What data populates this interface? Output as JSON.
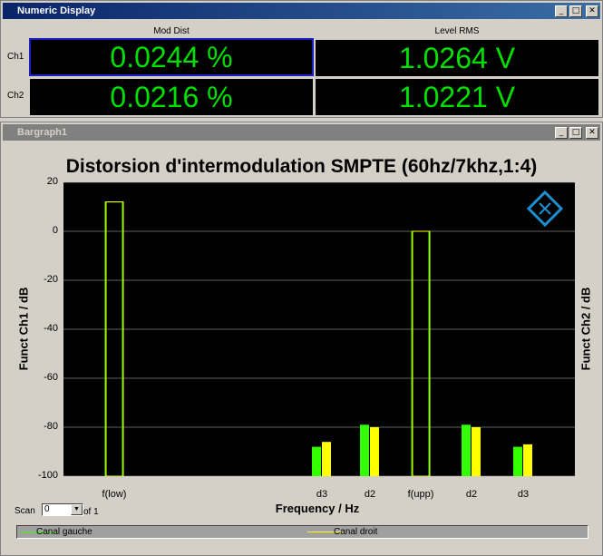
{
  "numeric": {
    "title": "Numeric Display",
    "col1": "Mod Dist",
    "col2": "Level RMS",
    "rows": [
      {
        "label": "Ch1",
        "mod": "0.0244 %",
        "level": "1.0264 V"
      },
      {
        "label": "Ch2",
        "mod": "0.0216 %",
        "level": "1.0221 V"
      }
    ]
  },
  "bargraph": {
    "title": "Bargraph1",
    "scan_label": "Scan",
    "scan_value": "0",
    "scan_of": "of 1"
  },
  "window_buttons": {
    "minimize": "_",
    "maximize": "□",
    "close": "✕"
  },
  "colors": {
    "green": "#33ff00",
    "yellow": "#ffff00",
    "value_text": "#00e000"
  },
  "chart_data": {
    "type": "bar",
    "title": "Distorsion d'intermodulation SMPTE (60hz/7khz,1:4)",
    "xlabel": "Frequency / Hz",
    "ylabel": "Funct Ch1 / dB",
    "ylabel_right": "Funct Ch2 / dB",
    "ylim": [
      -100,
      20
    ],
    "yticks": [
      "20",
      "0",
      "-20",
      "-40",
      "-60",
      "-80",
      "-100"
    ],
    "grid": true,
    "categories": [
      "f(low)",
      "d3",
      "d2",
      "f(upp)",
      "d2",
      "d3"
    ],
    "series": [
      {
        "name": "Canal gauche",
        "values": [
          12,
          -88,
          -79,
          0,
          -79,
          -88
        ]
      },
      {
        "name": "Canal droit",
        "values": [
          12,
          -86,
          -80,
          0,
          -80,
          -87
        ]
      }
    ]
  }
}
